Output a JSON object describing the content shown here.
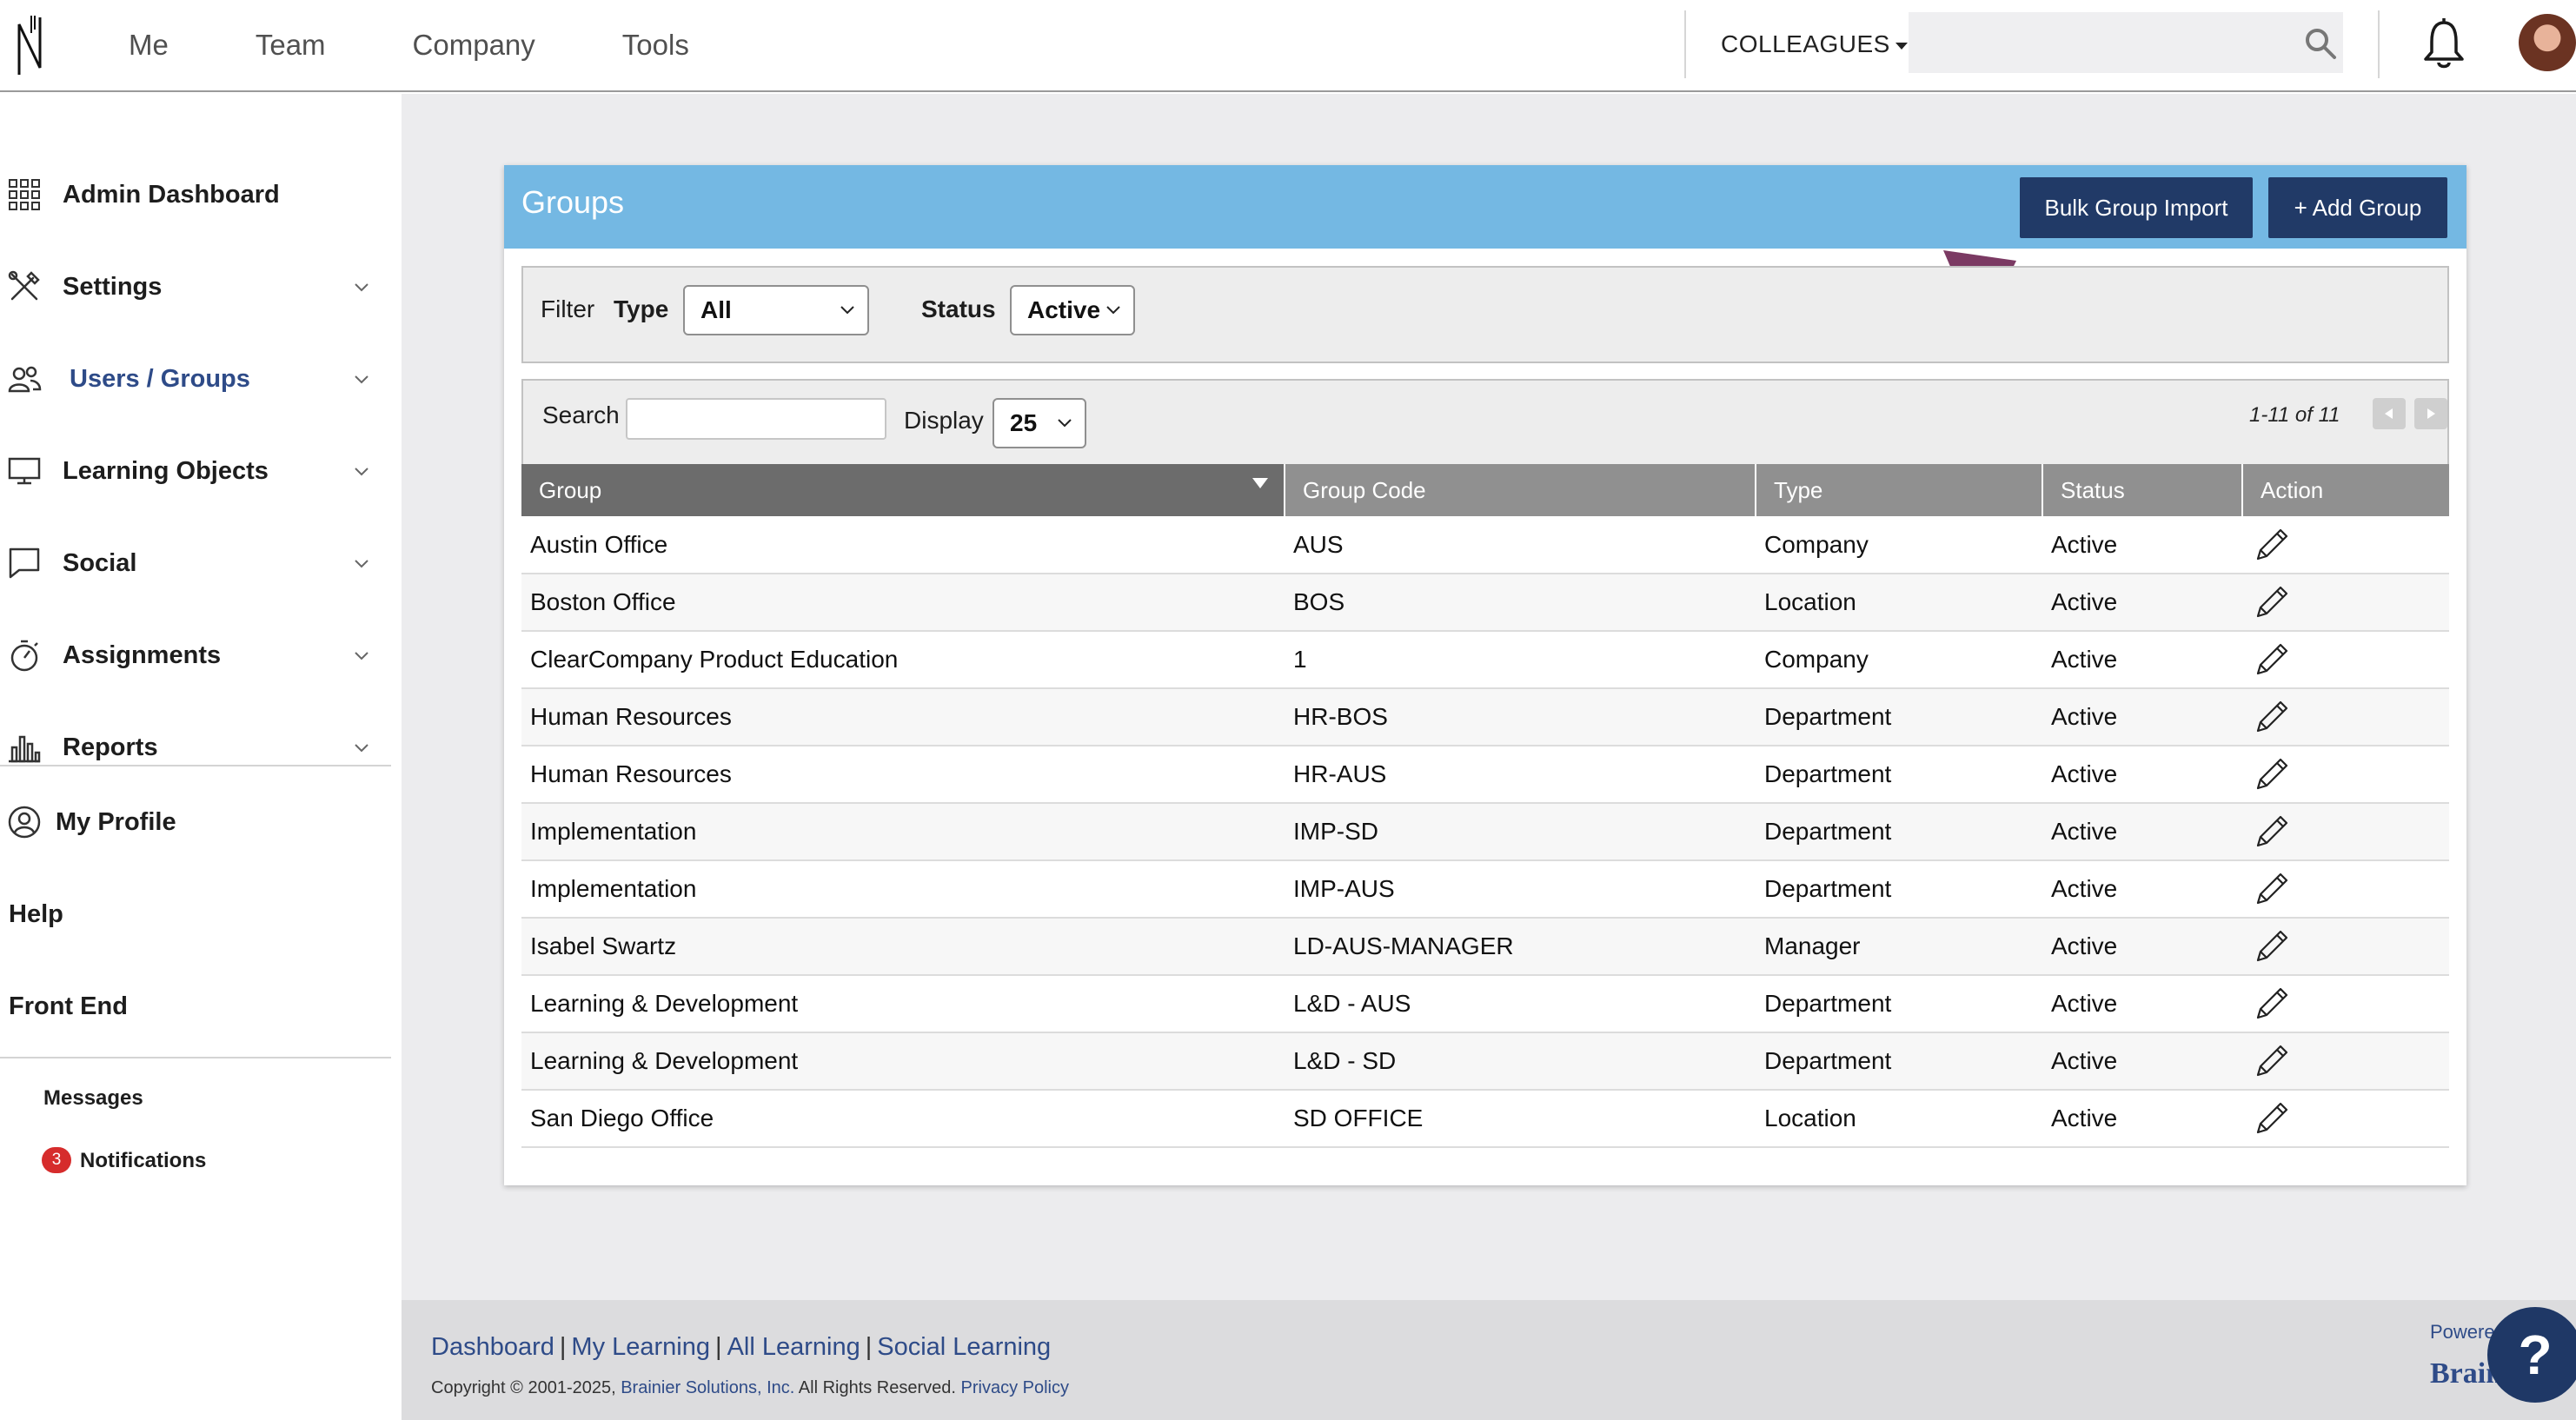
{
  "topnav": {
    "items": [
      "Me",
      "Team",
      "Company",
      "Tools"
    ],
    "colleagues_label": "COLLEAGUES",
    "search_placeholder": ""
  },
  "sidebar": {
    "items": [
      {
        "label": "Admin Dashboard",
        "icon": "grid-icon"
      },
      {
        "label": "Settings",
        "icon": "tools-icon"
      },
      {
        "label": "Users / Groups",
        "icon": "users-icon"
      },
      {
        "label": "Learning Objects",
        "icon": "monitor-icon"
      },
      {
        "label": "Social",
        "icon": "chat-icon"
      },
      {
        "label": "Assignments",
        "icon": "stopwatch-icon"
      },
      {
        "label": "Reports",
        "icon": "bar-chart-icon"
      }
    ],
    "my_profile": "My Profile",
    "help": "Help",
    "front_end": "Front End",
    "messages": "Messages",
    "notifications": "Notifications",
    "notification_count": "3"
  },
  "groups": {
    "title": "Groups",
    "bulk_import_label": "Bulk Group Import",
    "add_group_label": "+ Add Group",
    "filter": {
      "label": "Filter",
      "type_label": "Type",
      "type_value": "All",
      "status_label": "Status",
      "status_value": "Active"
    },
    "search_label": "Search",
    "display_label": "Display",
    "display_value": "25",
    "pager_text": "1-11 of 11",
    "columns": [
      "Group",
      "Group Code",
      "Type",
      "Status",
      "Action"
    ],
    "rows": [
      {
        "group": "Austin Office",
        "code": "AUS",
        "type": "Company",
        "status": "Active"
      },
      {
        "group": "Boston Office",
        "code": "BOS",
        "type": "Location",
        "status": "Active"
      },
      {
        "group": "ClearCompany Product Education",
        "code": "1",
        "type": "Company",
        "status": "Active"
      },
      {
        "group": "Human Resources",
        "code": "HR-BOS",
        "type": "Department",
        "status": "Active"
      },
      {
        "group": "Human Resources",
        "code": "HR-AUS",
        "type": "Department",
        "status": "Active"
      },
      {
        "group": "Implementation",
        "code": "IMP-SD",
        "type": "Department",
        "status": "Active"
      },
      {
        "group": "Implementation",
        "code": "IMP-AUS",
        "type": "Department",
        "status": "Active"
      },
      {
        "group": "Isabel Swartz",
        "code": "LD-AUS-MANAGER",
        "type": "Manager",
        "status": "Active"
      },
      {
        "group": "Learning & Development",
        "code": "L&D - AUS",
        "type": "Department",
        "status": "Active"
      },
      {
        "group": "Learning & Development",
        "code": "L&D - SD",
        "type": "Department",
        "status": "Active"
      },
      {
        "group": "San Diego Office",
        "code": "SD OFFICE",
        "type": "Location",
        "status": "Active"
      }
    ]
  },
  "footer": {
    "links": [
      "Dashboard",
      "My Learning",
      "All Learning",
      "Social Learning"
    ],
    "copyright_prefix": "Copyright © 2001-2025,",
    "company_link": "Brainier Solutions, Inc.",
    "rights": "All Rights Reserved.",
    "privacy_link": "Privacy Policy",
    "powered": "Powered",
    "brand": "Brain"
  },
  "help_label": "?",
  "colors": {
    "header_blue": "#74b8e3",
    "button_navy": "#213a67",
    "arrow": "#7b3a63",
    "badge_red": "#d62c2c"
  }
}
